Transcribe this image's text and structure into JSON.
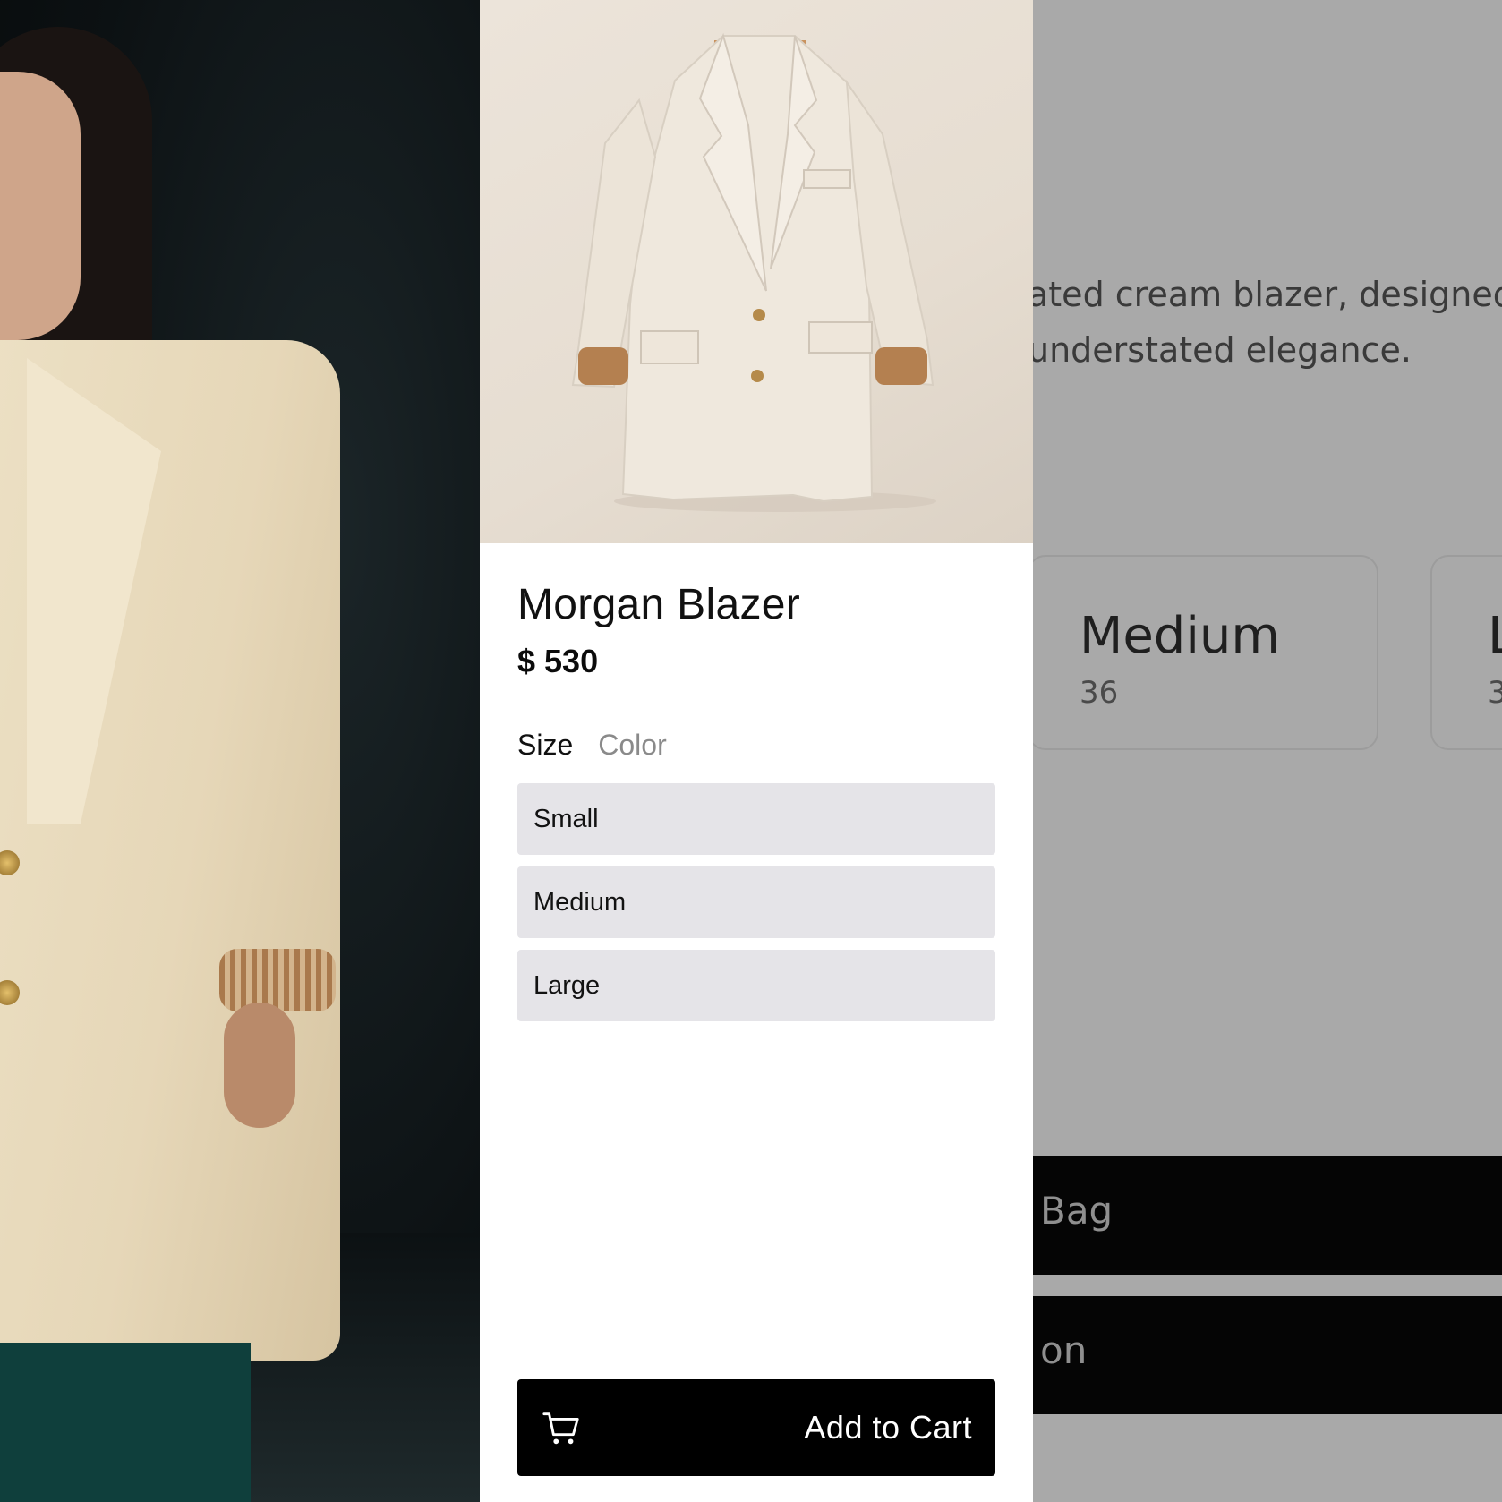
{
  "product": {
    "title": "Morgan Blazer",
    "price": "$ 530"
  },
  "options": {
    "tabs": [
      {
        "label": "Size",
        "active": true
      },
      {
        "label": "Color",
        "active": false
      }
    ],
    "sizes": [
      "Small",
      "Medium",
      "Large"
    ]
  },
  "actions": {
    "add_to_cart": "Add to Cart",
    "cart_icon": "cart-icon"
  },
  "background_page": {
    "description_lines": [
      "ated cream blazer, designed",
      "understated elegance."
    ],
    "size_cards": [
      {
        "name": "Medium",
        "value": "36"
      },
      {
        "name": "L",
        "value": "3"
      }
    ],
    "buttons": [
      "Bag",
      "on"
    ]
  },
  "colors": {
    "panel_bg": "#ffffff",
    "option_bg": "#e5e4e8",
    "button_bg": "#000000",
    "overlay_gray": "#a9a9a9",
    "inactive_tab": "#8a8a8a"
  }
}
